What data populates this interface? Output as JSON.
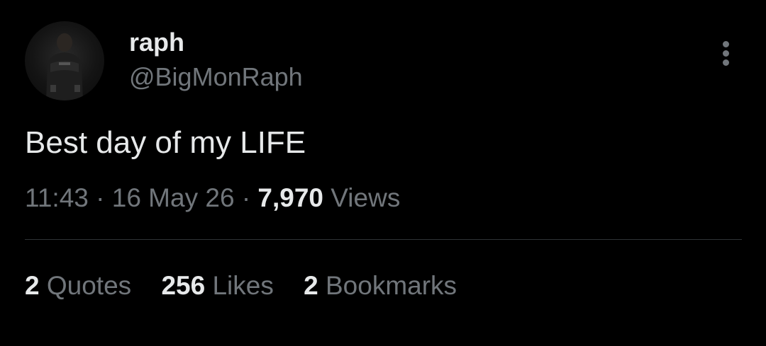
{
  "author": {
    "display_name": "raph",
    "handle": "@BigMonRaph",
    "avatar_icon": "user-avatar-photo"
  },
  "tweet": {
    "text": "Best day of my LIFE",
    "time": "11:43",
    "separator": "·",
    "date": "16 May 26",
    "views_count": "7,970",
    "views_label": "Views"
  },
  "stats": [
    {
      "count": "2",
      "label": "Quotes"
    },
    {
      "count": "256",
      "label": "Likes"
    },
    {
      "count": "2",
      "label": "Bookmarks"
    }
  ],
  "colors": {
    "background": "#000000",
    "primary_text": "#e7e9ea",
    "secondary_text": "#71767b",
    "divider": "#2f3336"
  },
  "icons": {
    "more": "more-vertical-icon"
  }
}
